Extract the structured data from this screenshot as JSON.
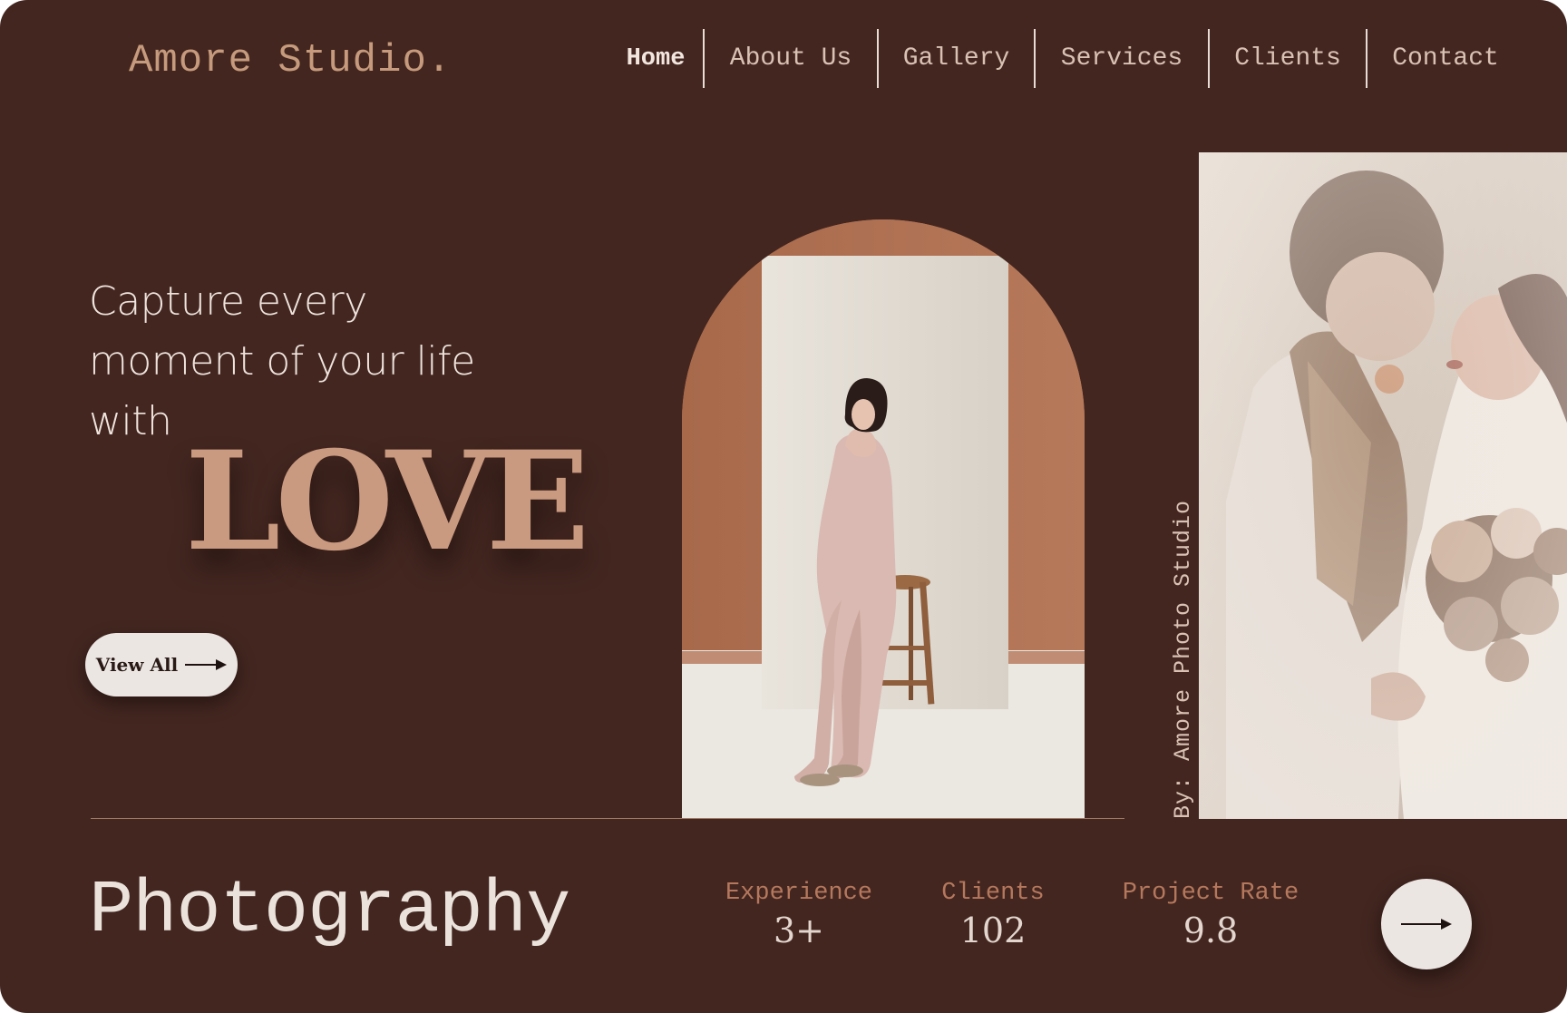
{
  "brand": {
    "logo": "Amore Studio."
  },
  "nav": {
    "items": [
      {
        "label": "Home",
        "active": true
      },
      {
        "label": "About Us"
      },
      {
        "label": "Gallery"
      },
      {
        "label": "Services"
      },
      {
        "label": "Clients"
      },
      {
        "label": "Contact"
      }
    ]
  },
  "hero": {
    "headline_lines": [
      "Capture every",
      "moment of your life",
      "with"
    ],
    "emphasis": "LOVE",
    "cta_label": "View All",
    "cta_icon": "arrow-right-icon",
    "vertical_credit": "By: Amore Photo Studio"
  },
  "footer": {
    "title": "Photography",
    "stats": [
      {
        "label": "Experience",
        "value": "3+"
      },
      {
        "label": "Clients",
        "value": "102"
      },
      {
        "label": "Project Rate",
        "value": "9.8"
      }
    ],
    "next_icon": "arrow-right-icon"
  },
  "colors": {
    "background": "#432620",
    "accent": "#c99a80",
    "logo": "#c69a7c",
    "stat_label": "#b5785d",
    "button": "#ece6e3"
  }
}
